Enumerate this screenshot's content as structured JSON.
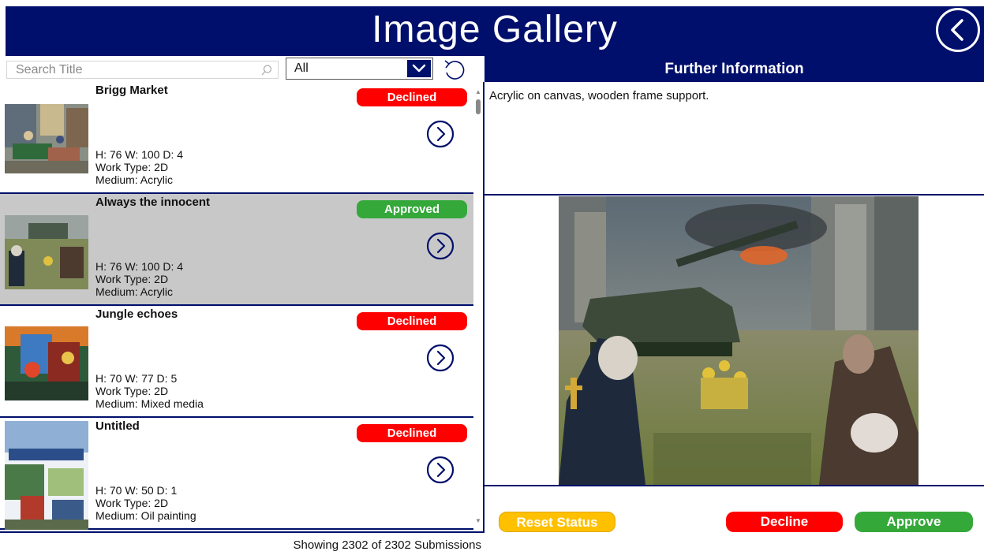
{
  "app": {
    "title": "Image Gallery"
  },
  "toolbar": {
    "search_placeholder": "Search Title",
    "search_value": "",
    "filter_selected": "All"
  },
  "gallery": {
    "items": [
      {
        "title": "Brigg Market",
        "status": "Declined",
        "dims": "H: 76 W: 100 D: 4",
        "work_type": "Work Type: 2D",
        "medium": "Medium: Acrylic"
      },
      {
        "title": "Always the innocent",
        "status": "Approved",
        "dims": "H: 76 W: 100 D: 4",
        "work_type": "Work Type: 2D",
        "medium": "Medium: Acrylic",
        "selected": true
      },
      {
        "title": "Jungle echoes",
        "status": "Declined",
        "dims": "H: 70 W: 77 D: 5",
        "work_type": "Work Type: 2D",
        "medium": "Medium: Mixed media"
      },
      {
        "title": "Untitled",
        "status": "Declined",
        "dims": "H: 70 W: 50 D: 1",
        "work_type": "Work Type: 2D",
        "medium": "Medium: Oil painting"
      }
    ],
    "showing_text": "Showing 2302 of 2302 Submissions"
  },
  "further_info": {
    "header": "Further Information",
    "description": "Acrylic on canvas, wooden frame support."
  },
  "actions": {
    "reset_label": "Reset Status",
    "decline_label": "Decline",
    "approve_label": "Approve"
  },
  "colors": {
    "brand_navy": "#000f6b",
    "declined": "#ff0000",
    "approved": "#35a83a",
    "reset": "#ffc000",
    "selected_row": "#c8c8c8"
  },
  "icons": {
    "back": "chevron-left-circle-icon",
    "search": "search-icon",
    "dropdown": "chevron-down-icon",
    "reset_filter": "undo-icon",
    "item_detail": "chevron-right-circle-icon"
  }
}
